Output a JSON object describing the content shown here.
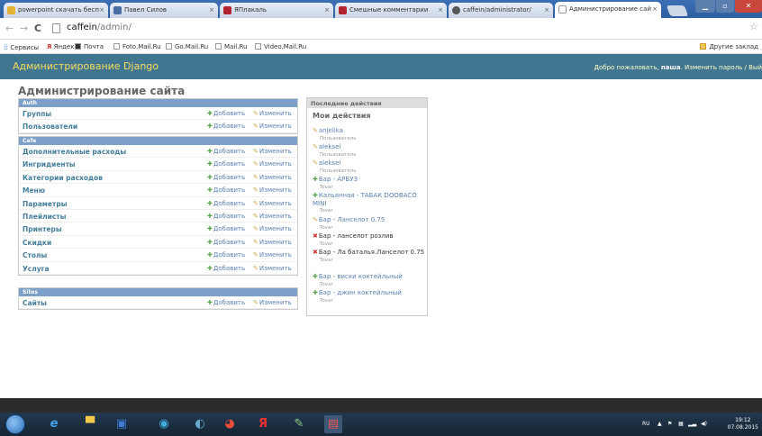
{
  "browser": {
    "tabs": [
      {
        "label": "powerpoint скачать бесп",
        "icon": "ya-icon"
      },
      {
        "label": "Павел Силов",
        "icon": "vk-icon"
      },
      {
        "label": "ЯПлакаль",
        "icon": "yap-icon"
      },
      {
        "label": "Смешные комментарии",
        "icon": "yap-icon"
      },
      {
        "label": "caffein/administrator/",
        "icon": "github-icon"
      },
      {
        "label": "Администрирование сай",
        "icon": "page-icon",
        "active": true
      }
    ],
    "close_glyph": "×",
    "url_host": "caffein",
    "url_path": "/admin/",
    "bookmarks": [
      "Сервисы",
      "Яндекс",
      "Почта",
      "Foto.Mail.Ru",
      "Go.Mail.Ru",
      "Mail.Ru",
      "Video.Mail.Ru"
    ],
    "other_bookmarks": "Другие заклад"
  },
  "admin": {
    "branding": "Администрирование Django",
    "welcome": "Добро пожаловать,",
    "username": "паша",
    "tools_rest": ". Изменить пароль / Вый",
    "page_title": "Администрирование сайта",
    "add_label": "Добавить",
    "change_label": "Изменить",
    "modules": [
      {
        "caption": "Auth",
        "rows": [
          "Группы",
          "Пользователи"
        ]
      },
      {
        "caption": "Cafe",
        "rows": [
          "Дополнительные расходы",
          "Ингридиенты",
          "Категории расходов",
          "Меню",
          "Параметры",
          "Плейлисты",
          "Принтеры",
          "Скидки",
          "Столы",
          "Услуга"
        ]
      },
      {
        "caption": "Sites",
        "rows": [
          "Сайты"
        ]
      }
    ],
    "recent": {
      "caption": "Последние действия",
      "subtitle": "Мои действия",
      "items": [
        {
          "action": "change",
          "text": "anjelika",
          "type": "Пользователь",
          "linked": true
        },
        {
          "action": "change",
          "text": "aleksei",
          "type": "Пользователь",
          "linked": true
        },
        {
          "action": "change",
          "text": "aleksei",
          "type": "Пользователь",
          "linked": true
        },
        {
          "action": "add",
          "text": "Бар - АРБУЗ",
          "type": "Tovar",
          "linked": true
        },
        {
          "action": "add",
          "text": "Кальянная - ТАБАК DOOBACO MINI",
          "type": "Tovar",
          "linked": true
        },
        {
          "action": "change",
          "text": "Бар - Ланселот 0.75",
          "type": "Tovar",
          "linked": true
        },
        {
          "action": "delete",
          "text": "Бар - ланселот розлив",
          "type": "Tovar",
          "linked": false
        },
        {
          "action": "delete",
          "text": "Бар - Ла баталья.Ланселот 0.75",
          "type": "Tovar",
          "linked": false
        },
        {
          "action": "add",
          "text": "Бар - виски коктейльный",
          "type": "Tovar",
          "linked": true
        },
        {
          "action": "add",
          "text": "Бар - джин коктейльный",
          "type": "Tovar",
          "linked": true
        }
      ]
    }
  },
  "taskbar": {
    "lang": "RU",
    "time": "19:12",
    "date": "07.08.2015"
  }
}
